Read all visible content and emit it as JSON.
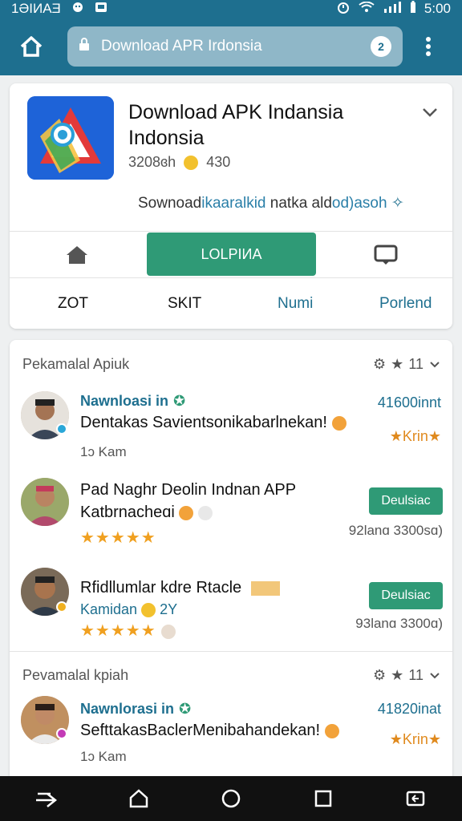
{
  "status_bar": {
    "left_text": "1ƏIИAƎ",
    "time": "5:00"
  },
  "browser": {
    "url": "Download APR Irdonsia"
  },
  "app": {
    "title": "Download APK Indansia Indonsia",
    "downloads": "3208ɞh",
    "rating": "430",
    "description_prefix": "Sownoad",
    "description_link": "ikaaralkid",
    "description_mid": " natka ald",
    "description_link2": "od)asoh",
    "install_label": "LOLPIИA",
    "tabs": [
      "ZOT",
      "SKIT",
      "Numi",
      "Porlend"
    ]
  },
  "reviews_section_1": {
    "title": "Pekamalal Apiuk",
    "rating": "11"
  },
  "reviews_section_2": {
    "title": "Pevamalal kpiah",
    "rating": "11"
  },
  "reviews": [
    {
      "author": "Nawnloasi in",
      "text": "Dentakas Savientsonikabarlnekan!",
      "sub": "1ɔ Kam",
      "count": "41600innt",
      "right_label": "Κrin"
    },
    {
      "title": "Pad Naghr Deolin Indnan APP",
      "sub": "Katbrnacheɑi",
      "stars": "★★★★★",
      "button": "Deulsiac",
      "date": "92lanɑ 3300sɑ)"
    },
    {
      "title": "Rfidllumlar kdre Rtacle",
      "sub": "Kamidan",
      "sub_extra": "2Y",
      "stars": "★★★★★",
      "button": "Deulsiac",
      "date": "93lanɑ 3300ɑ)"
    },
    {
      "author": "Nawnlorasi in",
      "text": "SefttakasBaclerMenibahandekan!",
      "sub": "1ɔ Kam",
      "count": "41820inat",
      "right_label": "Κrin"
    }
  ],
  "colors": {
    "primary": "#1e6f8f",
    "accent_green": "#2f9a76",
    "star": "#f0a020"
  }
}
